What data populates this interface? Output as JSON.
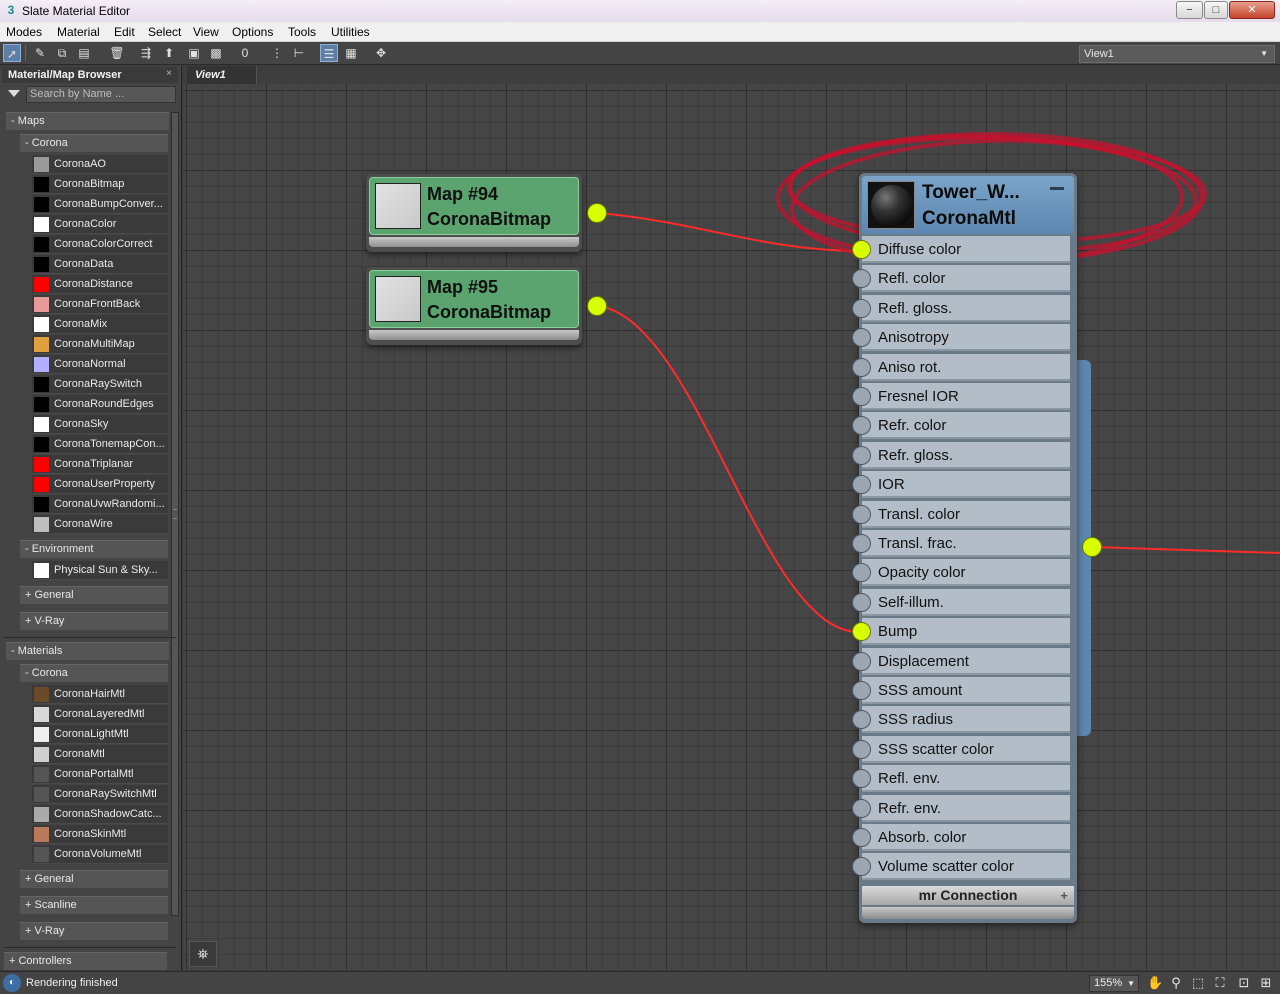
{
  "window": {
    "title": "Slate Material Editor",
    "minimize": "−",
    "maximize": "□",
    "close": "✕"
  },
  "menu": [
    "Modes",
    "Material",
    "Edit",
    "Select",
    "View",
    "Options",
    "Tools",
    "Utilities"
  ],
  "toolbar": {
    "view_selector": "View1"
  },
  "browser": {
    "title": "Material/Map Browser",
    "close": "×",
    "search_placeholder": "Search by Name ...",
    "maps_header": "- Maps",
    "corona_maps_header": "- Corona",
    "corona_maps": [
      {
        "label": "CoronaAO",
        "swatch": "#9a9a9a"
      },
      {
        "label": "CoronaBitmap",
        "swatch": "#000000"
      },
      {
        "label": "CoronaBumpConver...",
        "swatch": "#000000"
      },
      {
        "label": "CoronaColor",
        "swatch": "#ffffff"
      },
      {
        "label": "CoronaColorCorrect",
        "swatch": "#000000"
      },
      {
        "label": "CoronaData",
        "swatch": "#000000"
      },
      {
        "label": "CoronaDistance",
        "swatch": "#ff0000"
      },
      {
        "label": "CoronaFrontBack",
        "swatch": "#e89a9a"
      },
      {
        "label": "CoronaMix",
        "swatch": "#ffffff"
      },
      {
        "label": "CoronaMultiMap",
        "swatch": "#e0a040"
      },
      {
        "label": "CoronaNormal",
        "swatch": "#b0b0ff"
      },
      {
        "label": "CoronaRaySwitch",
        "swatch": "#000000"
      },
      {
        "label": "CoronaRoundEdges",
        "swatch": "#000000"
      },
      {
        "label": "CoronaSky",
        "swatch": "#ffffff"
      },
      {
        "label": "CoronaTonemapCon...",
        "swatch": "#000000"
      },
      {
        "label": "CoronaTriplanar",
        "swatch": "#ff0000"
      },
      {
        "label": "CoronaUserProperty",
        "swatch": "#ff0000"
      },
      {
        "label": "CoronaUvwRandomi...",
        "swatch": "#000000"
      },
      {
        "label": "CoronaWire",
        "swatch": "#bdbdbd"
      }
    ],
    "environment_header": "- Environment",
    "environment_items": [
      {
        "label": "Physical Sun & Sky...",
        "swatch": "#ffffff"
      }
    ],
    "maps_general": "+ General",
    "maps_vray": "+ V-Ray",
    "materials_header": "- Materials",
    "corona_mtls_header": "- Corona",
    "corona_mtls": [
      {
        "label": "CoronaHairMtl",
        "swatch": "#6b4a2a"
      },
      {
        "label": "CoronaLayeredMtl",
        "swatch": "#d8d8d8"
      },
      {
        "label": "CoronaLightMtl",
        "swatch": "#eeeeee"
      },
      {
        "label": "CoronaMtl",
        "swatch": "#cfcfcf"
      },
      {
        "label": "CoronaPortalMtl",
        "swatch": "#555555"
      },
      {
        "label": "CoronaRaySwitchMtl",
        "swatch": "#555555"
      },
      {
        "label": "CoronaShadowCatc...",
        "swatch": "#aaaaaa"
      },
      {
        "label": "CoronaSkinMtl",
        "swatch": "#b87a5a"
      },
      {
        "label": "CoronaVolumeMtl",
        "swatch": "#555555"
      }
    ],
    "mtl_general": "+ General",
    "mtl_scanline": "+ Scanline",
    "mtl_vray": "+ V-Ray",
    "controllers": "+ Controllers"
  },
  "view_tab": "View1",
  "nodes": {
    "map94": {
      "name": "Map #94",
      "type": "CoronaBitmap"
    },
    "map95": {
      "name": "Map #95",
      "type": "CoronaBitmap"
    },
    "material": {
      "name": "Tower_W...",
      "type": "CoronaMtl",
      "slots": [
        {
          "label": "Diffuse color",
          "connected": true
        },
        {
          "label": "Refl. color",
          "connected": false
        },
        {
          "label": "Refl. gloss.",
          "connected": false
        },
        {
          "label": "Anisotropy",
          "connected": false
        },
        {
          "label": "Aniso rot.",
          "connected": false
        },
        {
          "label": "Fresnel IOR",
          "connected": false
        },
        {
          "label": "Refr. color",
          "connected": false
        },
        {
          "label": "Refr. gloss.",
          "connected": false
        },
        {
          "label": "IOR",
          "connected": false
        },
        {
          "label": "Transl. color",
          "connected": false
        },
        {
          "label": "Transl. frac.",
          "connected": false
        },
        {
          "label": "Opacity color",
          "connected": false
        },
        {
          "label": "Self-illum.",
          "connected": false
        },
        {
          "label": "Bump",
          "connected": true
        },
        {
          "label": "Displacement",
          "connected": false
        },
        {
          "label": "SSS amount",
          "connected": false
        },
        {
          "label": "SSS radius",
          "connected": false
        },
        {
          "label": "SSS scatter color",
          "connected": false
        },
        {
          "label": "Refl. env.",
          "connected": false
        },
        {
          "label": "Refr. env.",
          "connected": false
        },
        {
          "label": "Absorb. color",
          "connected": false
        },
        {
          "label": "Volume scatter color",
          "connected": false
        }
      ],
      "mr_connection": "mr Connection",
      "mr_plus": "+"
    }
  },
  "status": {
    "message": "Rendering finished",
    "zoom": "155%"
  },
  "colors": {
    "wire": "#ff2a2a",
    "socket_active": "#d8ff00",
    "annotation": "#c8102e",
    "map_node": "#5ca46f",
    "material_header": "#5d87b0"
  }
}
